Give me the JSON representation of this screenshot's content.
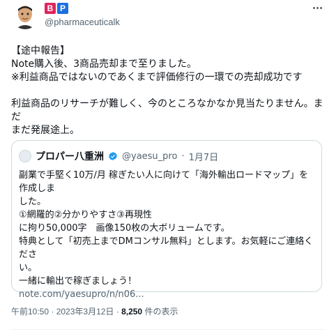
{
  "author": {
    "badges": [
      {
        "letter": "B",
        "color": "#e0245e"
      },
      {
        "letter": "P",
        "color": "#1d6fe0"
      }
    ],
    "handle": "@pharmaceuticalk"
  },
  "tweet": {
    "lines": [
      "【途中報告】",
      "Note購入後、3商品売却まで至りました。",
      "※利益商品ではないのであくまで評価修行の一環での売却成功です",
      "",
      "利益商品のリサーチが難しく、今のところなかなか見当たりません。まだ",
      "まだ発展途上。"
    ]
  },
  "quote": {
    "name": "プロパー八重洲",
    "handle": "@yaesu_pro",
    "separator": "·",
    "date": "1月7日",
    "lines": [
      "副業で手堅く10万/月 稼ぎたい人に向けて「海外輸出ロードマップ」を作成しま",
      "した。",
      "①網羅的②分かりやすさ③再現性",
      "に拘り50,000字　画像150枚の大ボリュームです。",
      "特典として「初売上までDMコンサル無料」とします。お気軽にご連絡くださ",
      "い。",
      "一緒に輸出で稼ぎましょう！"
    ],
    "link": "note.com/yaesupro/n/n06..."
  },
  "footer": {
    "timestamp": "午前10:50 · 2023年3月12日 · ",
    "views": "8,250",
    "views_label": " 件の表示"
  }
}
